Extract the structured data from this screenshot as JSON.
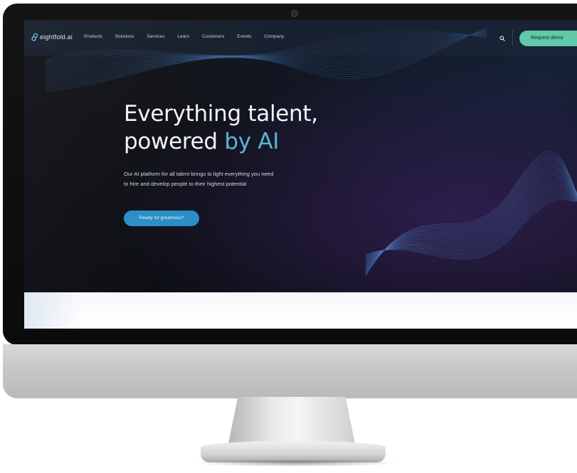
{
  "brand": {
    "name": "eightfold.ai",
    "accent": "#5fc9a8",
    "link_blue": "#58b6d8"
  },
  "nav": {
    "items": [
      {
        "label": "Products"
      },
      {
        "label": "Solutions"
      },
      {
        "label": "Services"
      },
      {
        "label": "Learn"
      },
      {
        "label": "Customers"
      },
      {
        "label": "Events"
      },
      {
        "label": "Company"
      }
    ],
    "cta_label": "Request demo",
    "search_icon": "search-icon"
  },
  "hero": {
    "title_line1": "Everything talent,",
    "title_line2_plain": "powered ",
    "title_line2_accent": "by AI",
    "subtitle_line1": "Our AI platform for all talent brings to light everything you need",
    "subtitle_line2": "to hire and develop people to their highest potential",
    "button_label": "Ready for greatness?"
  }
}
